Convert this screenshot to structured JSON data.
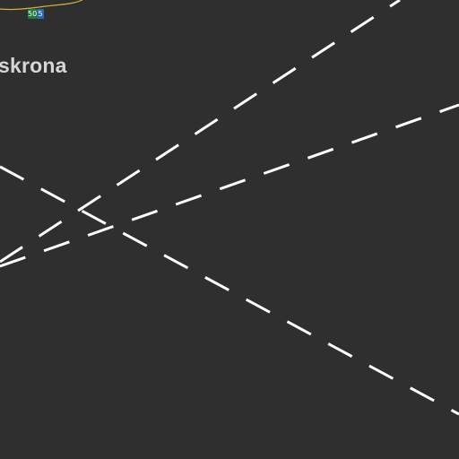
{
  "map": {
    "background_color": "#2f2f2f",
    "place_label": "skrona",
    "road_badges": [
      {
        "text": "50",
        "color": "#1d7a3a"
      },
      {
        "text": "5",
        "color": "#2a6aa8"
      }
    ],
    "road_color": "#d4b040",
    "ferry_route_color": "#ffffff",
    "ferry_route_count": 3
  }
}
